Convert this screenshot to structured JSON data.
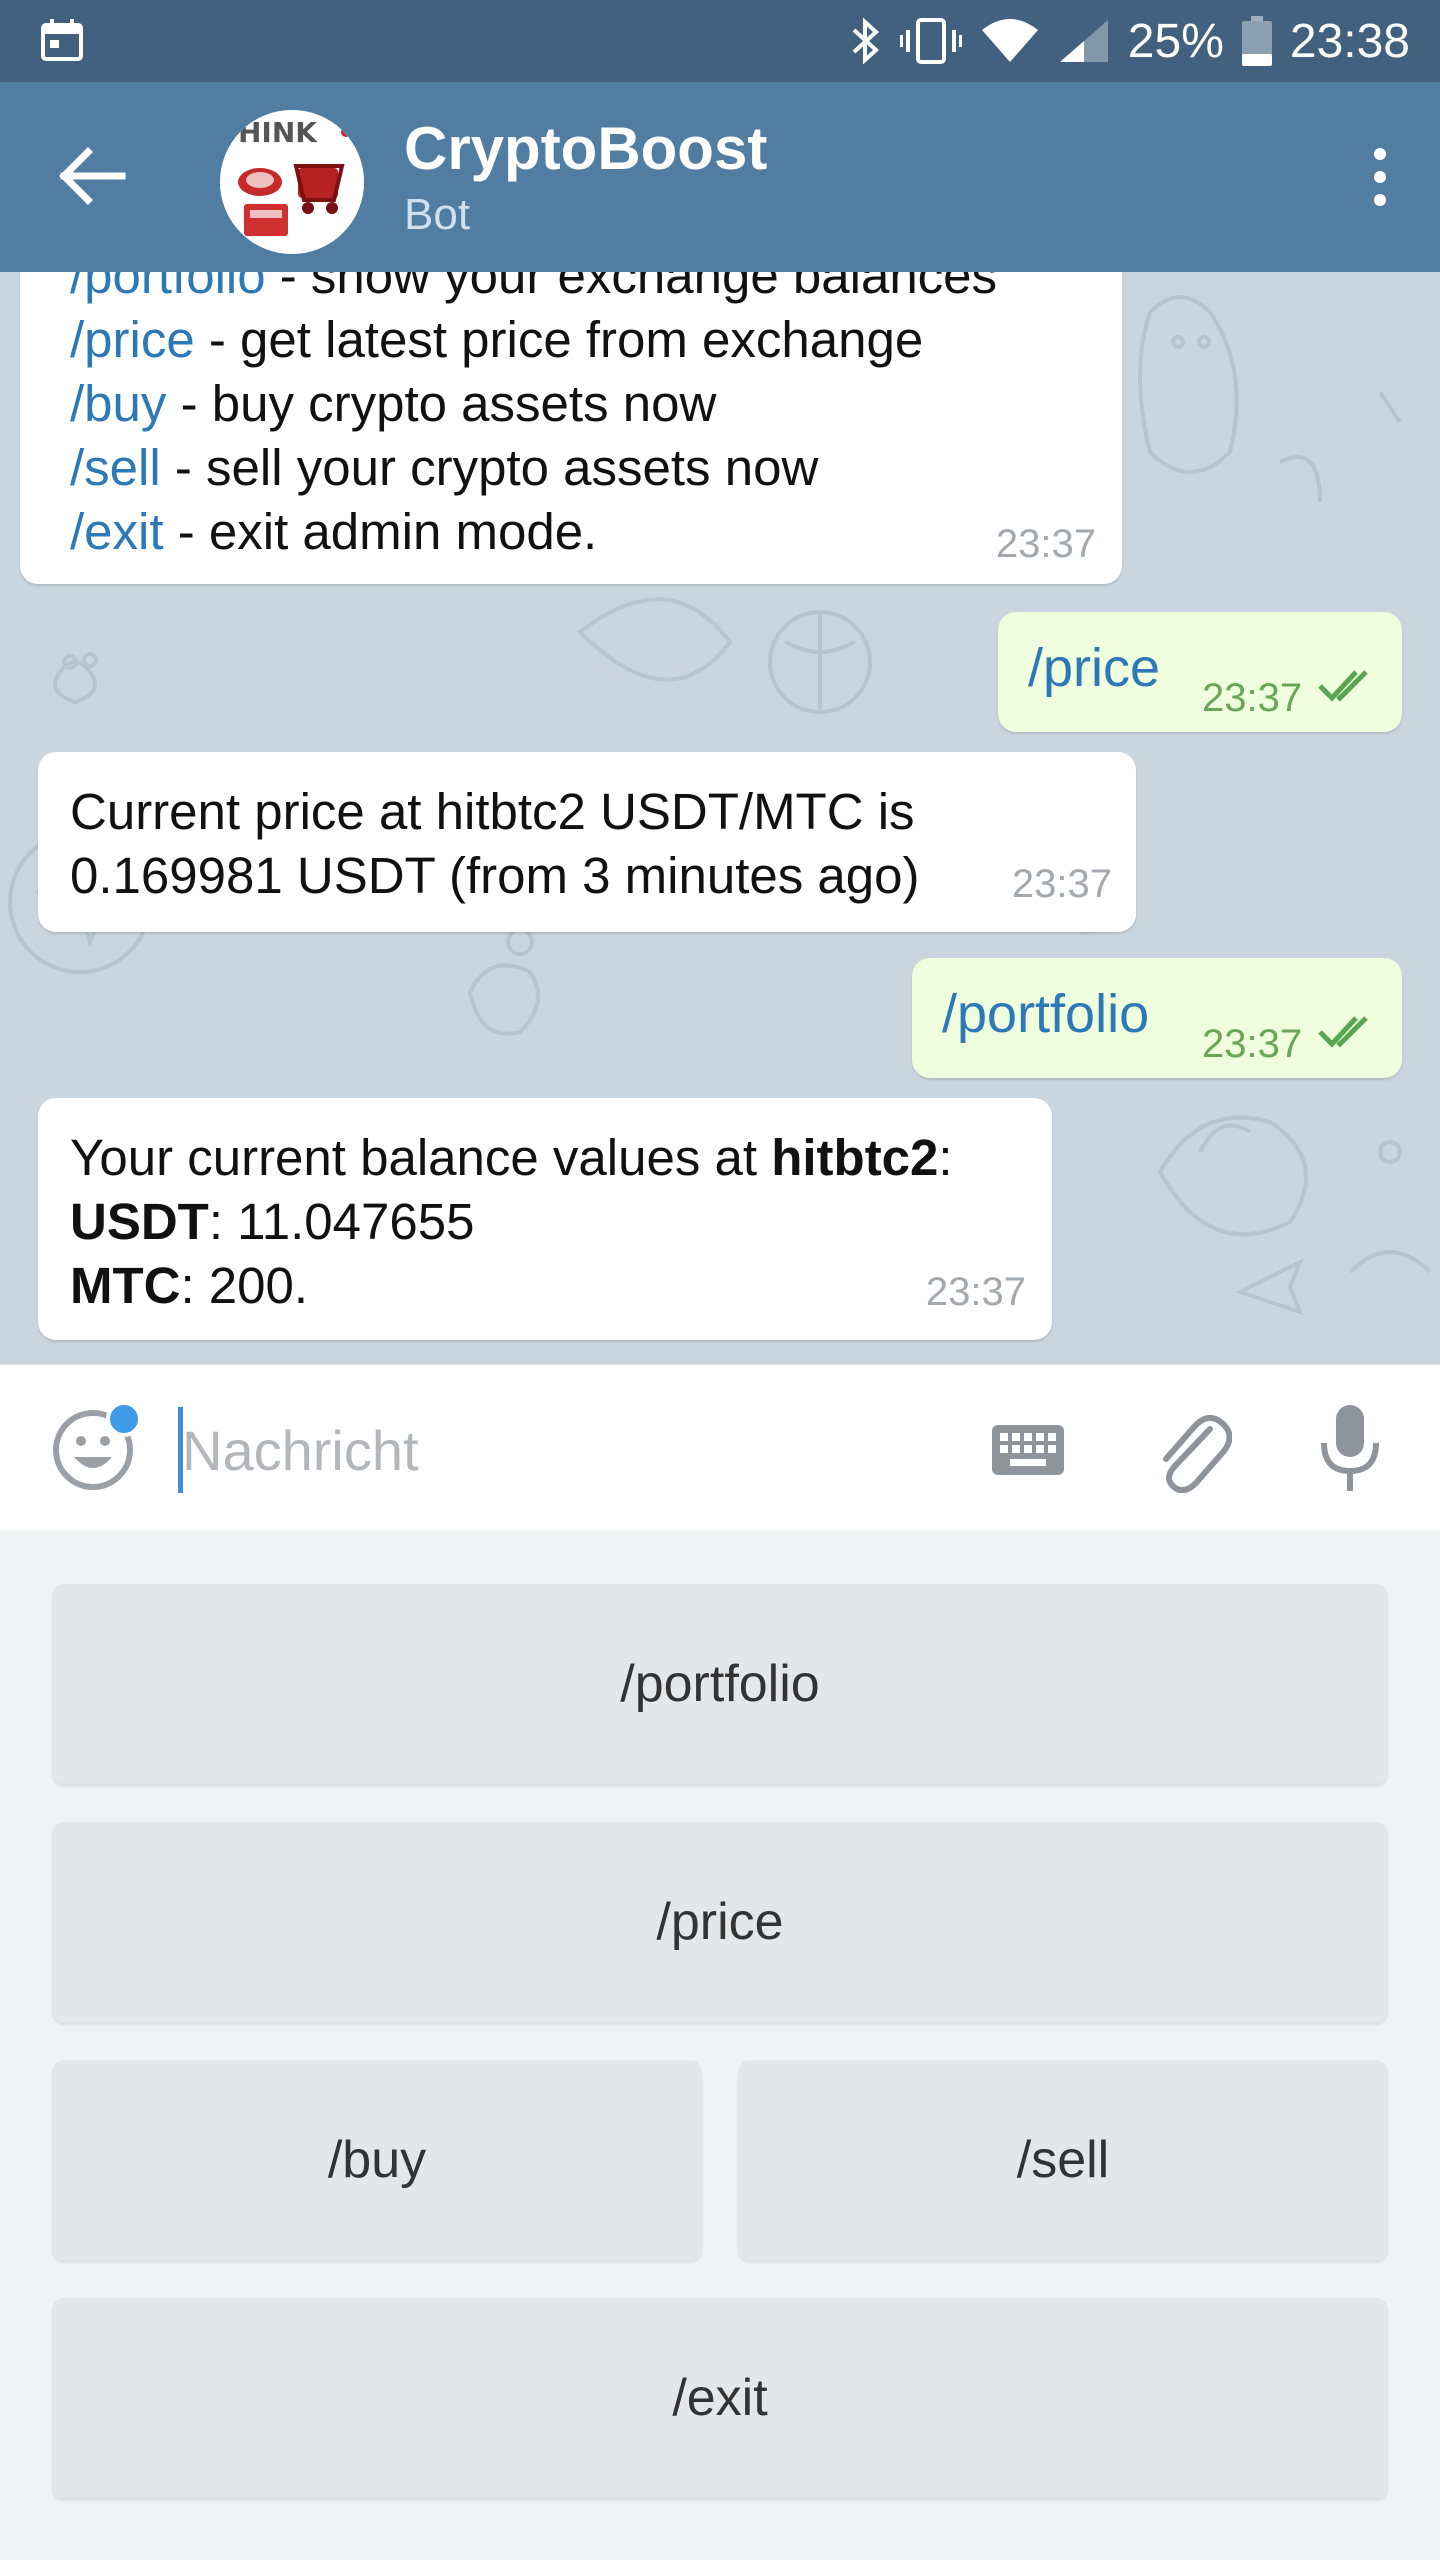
{
  "status_bar": {
    "battery": "25%",
    "time": "23:38",
    "icons": [
      "calendar-icon",
      "bluetooth-icon",
      "vibrate-icon",
      "wifi-icon",
      "signal-icon",
      "battery-icon"
    ]
  },
  "header": {
    "title": "CryptoBoost",
    "subtitle": "Bot",
    "avatar_text": "HINK"
  },
  "messages": {
    "help": {
      "lines": [
        {
          "cmd": "/portfolio",
          "desc": " - show your exchange balances"
        },
        {
          "cmd": "/price",
          "desc": " - get latest price from exchange"
        },
        {
          "cmd": "/buy",
          "desc": " - buy crypto assets now"
        },
        {
          "cmd": "/sell",
          "desc": " - sell your crypto assets now"
        },
        {
          "cmd": "/exit",
          "desc": " - exit admin mode."
        }
      ],
      "time": "23:37"
    },
    "out_price": {
      "text": "/price",
      "time": "23:37"
    },
    "price_reply": {
      "line1": "Current price at hitbtc2 USDT/MTC is",
      "line2": "0.169981 USDT (from 3 minutes ago)",
      "time": "23:37"
    },
    "out_portfolio": {
      "text": "/portfolio",
      "time": "23:37"
    },
    "balance_reply": {
      "intro": "Your current balance values at ",
      "exchange": "hitbtc2",
      "colon": ":",
      "usdt_label": "USDT",
      "usdt_value": ": 11.047655",
      "mtc_label": "MTC",
      "mtc_value": ": 200.",
      "time": "23:37"
    }
  },
  "composer": {
    "placeholder": "Nachricht"
  },
  "bot_keyboard": {
    "portfolio": "/portfolio",
    "price": "/price",
    "buy": "/buy",
    "sell": "/sell",
    "exit": "/exit"
  },
  "colors": {
    "statusbar": "#42617f",
    "appbar": "#527da3",
    "command_link": "#2d78b6",
    "outgoing_bubble": "#effedd",
    "chat_background": "#c9d6df"
  }
}
